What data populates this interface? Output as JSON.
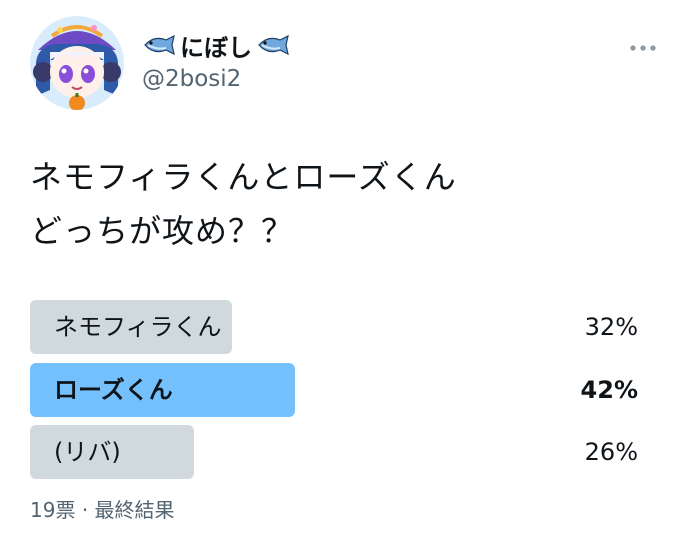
{
  "author": {
    "display_name_text": "にぼし",
    "left_emoji": "fish-icon",
    "right_emoji": "fish-icon",
    "handle": "@2bosi2",
    "avatar": "anime-witch-avatar"
  },
  "menu_icon": "more-icon",
  "tweet": {
    "lines": [
      "ネモフィラくんとローズくん",
      "どっちが攻め？？"
    ]
  },
  "poll": {
    "options": [
      {
        "label": "ネモフィラくん",
        "percent_text": "32%",
        "percent": 32,
        "winner": false
      },
      {
        "label": "ローズくん",
        "percent_text": "42%",
        "percent": 42,
        "winner": true
      },
      {
        "label": "(リバ)",
        "percent_text": "26%",
        "percent": 26,
        "winner": false
      }
    ],
    "votes": "19票",
    "separator": "·",
    "status": "最終結果"
  },
  "colors": {
    "winner_bar": "#74c0fc",
    "other_bar": "#cfd9de",
    "text": "#0f1419",
    "secondary_text": "#536471"
  }
}
